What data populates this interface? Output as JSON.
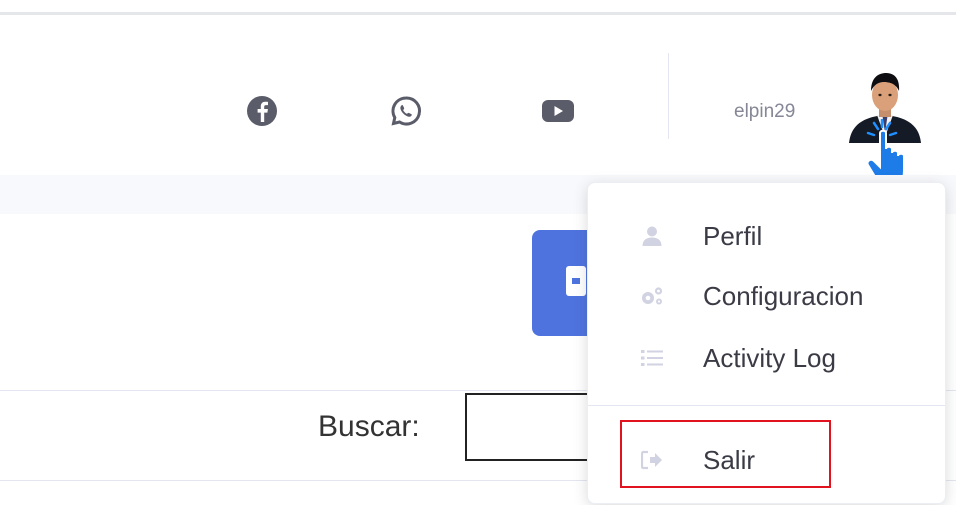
{
  "topbar": {
    "social": [
      {
        "name": "facebook-icon"
      },
      {
        "name": "whatsapp-icon"
      },
      {
        "name": "youtube-icon"
      }
    ],
    "username": "elpin29"
  },
  "content": {
    "search_label": "Buscar:",
    "search_value": ""
  },
  "user_menu": {
    "items": [
      {
        "label": "Perfil",
        "icon": "user-icon"
      },
      {
        "label": "Configuracion",
        "icon": "cogs-icon"
      },
      {
        "label": "Activity Log",
        "icon": "list-icon"
      }
    ],
    "logout": {
      "label": "Salir",
      "icon": "sign-out-icon"
    }
  },
  "colors": {
    "accent": "#4e73df",
    "icon_gray": "#5a5c69",
    "menu_icon": "#d1d3e2",
    "highlight": "#e0131e"
  }
}
